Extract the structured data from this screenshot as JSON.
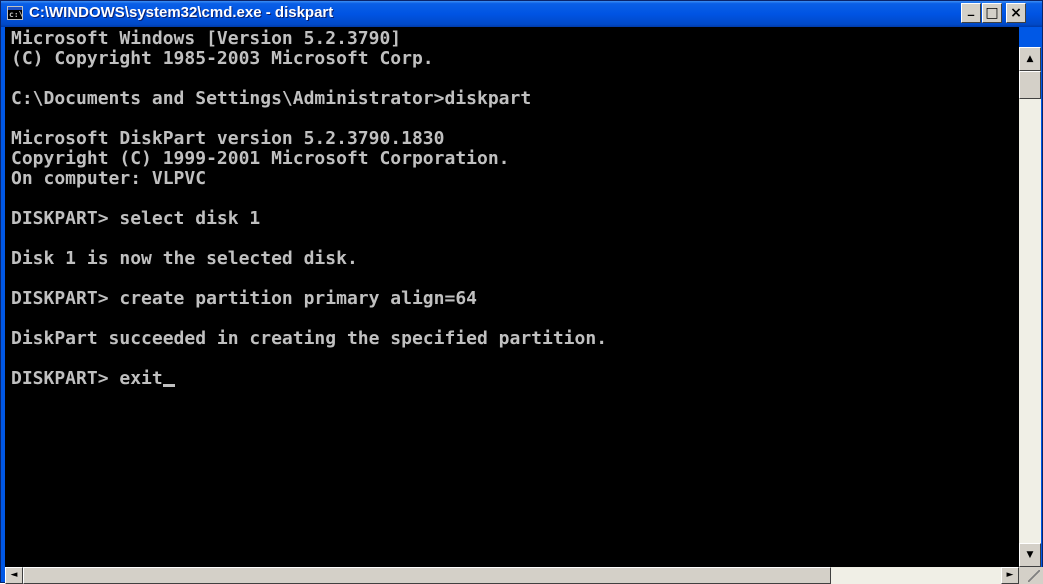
{
  "window": {
    "title": "C:\\WINDOWS\\system32\\cmd.exe - diskpart",
    "icon": "console-app-icon",
    "icon_label": "c:\\",
    "controls": {
      "minimize": "_",
      "maximize": "□",
      "close": "×"
    }
  },
  "console": {
    "lines": [
      "Microsoft Windows [Version 5.2.3790]",
      "(C) Copyright 1985-2003 Microsoft Corp.",
      "",
      "C:\\Documents and Settings\\Administrator>diskpart",
      "",
      "Microsoft DiskPart version 5.2.3790.1830",
      "Copyright (C) 1999-2001 Microsoft Corporation.",
      "On computer: VLPVC",
      "",
      "DISKPART> select disk 1",
      "",
      "Disk 1 is now the selected disk.",
      "",
      "DISKPART> create partition primary align=64",
      "",
      "DiskPart succeeded in creating the specified partition.",
      ""
    ],
    "prompt": "DISKPART> exit",
    "text_color": "#c0c0c0",
    "background_color": "#000000"
  },
  "scrollbar": {
    "up": "▲",
    "down": "▼",
    "left": "◄",
    "right": "►"
  }
}
